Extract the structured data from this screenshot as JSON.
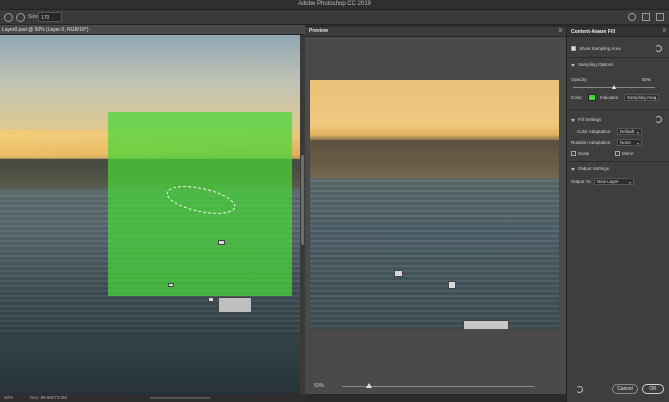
{
  "window": {
    "title": "Adobe Photoshop CC 2019"
  },
  "toolbar": {
    "size_label": "Size:",
    "size_value": "170"
  },
  "document": {
    "tab_label": "Layer0.psd @ 50% (Layer 0, RGB/16*)"
  },
  "status": {
    "zoom": "50%",
    "doc_info": "Doc: 89.6M/73.5M"
  },
  "preview": {
    "tab_label": "Preview",
    "zoom": "50%",
    "zoom_slider_value": 0.14
  },
  "panel": {
    "title": "Content-Aware Fill",
    "show_sampling_area": "Show Sampling Area",
    "sampling_options": "Sampling Options",
    "opacity_label": "Opacity:",
    "opacity_value": "50%",
    "opacity_fraction": 0.5,
    "color_label": "Color:",
    "indicates_label": "Indicates:",
    "indicates_value": "Sampling Area",
    "color_hex": "#46d737",
    "fill_settings": "Fill Settings",
    "color_adaptation_label": "Color Adaptation:",
    "color_adaptation_value": "Default",
    "rotation_adaptation_label": "Rotation Adaptation:",
    "rotation_adaptation_value": "None",
    "scale_label": "Scale",
    "mirror_label": "Mirror",
    "output_settings": "Output Settings",
    "output_to_label": "Output To:",
    "output_to_value": "New Layer",
    "cancel": "Cancel",
    "ok": "OK"
  }
}
